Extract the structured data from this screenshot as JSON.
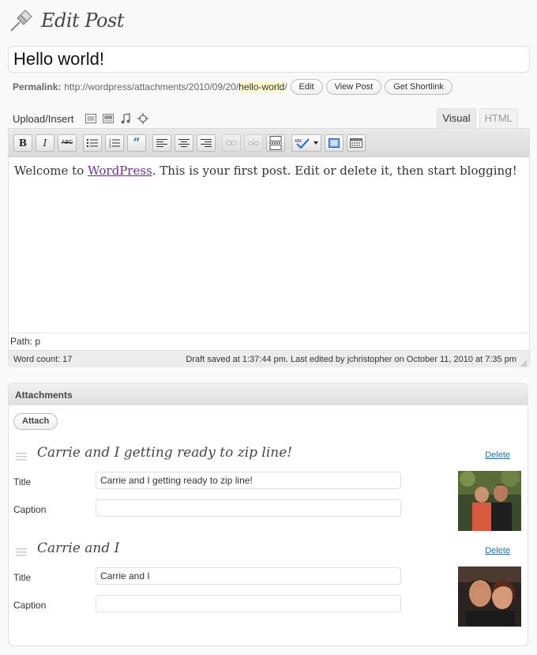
{
  "header": {
    "title": "Edit Post",
    "icon": "pushpin-icon"
  },
  "post_title": "Hello world!",
  "permalink": {
    "label": "Permalink:",
    "url_prefix": "http://wordpress/attachments/2010/09/20/",
    "slug": "hello-world",
    "url_suffix": "/",
    "edit_label": "Edit",
    "view_label": "View Post",
    "shortlink_label": "Get Shortlink"
  },
  "media": {
    "label": "Upload/Insert",
    "icons": [
      "image-icon",
      "video-icon",
      "audio-icon",
      "media-icon"
    ]
  },
  "tabs": {
    "visual": "Visual",
    "html": "HTML"
  },
  "toolbar": {
    "buttons": [
      "bold",
      "italic",
      "strikethrough",
      "unordered-list",
      "ordered-list",
      "blockquote",
      "align-left",
      "align-center",
      "align-right",
      "insert-link",
      "unlink",
      "insert-more",
      "spellcheck",
      "fullscreen",
      "kitchen-sink"
    ],
    "strike_label": "ABC"
  },
  "content": {
    "before_link": "Welcome to ",
    "link_text": "WordPress",
    "after_link": ". This is your first post. Edit or delete it, then start blogging!"
  },
  "path": "Path: p",
  "status": {
    "word_count": "Word count: 17",
    "draft_info": "Draft saved at 1:37:44 pm. Last edited by jchristopher on October 11, 2010 at 7:35 pm"
  },
  "attachments": {
    "header": "Attachments",
    "attach_label": "Attach",
    "items": [
      {
        "heading": "Carrie and I getting ready to zip line!",
        "delete_label": "Delete",
        "title_label": "Title",
        "title_value": "Carrie and I getting ready to zip line!",
        "caption_label": "Caption",
        "caption_value": ""
      },
      {
        "heading": "Carrie and I",
        "delete_label": "Delete",
        "title_label": "Title",
        "title_value": "Carrie and I",
        "caption_label": "Caption",
        "caption_value": ""
      }
    ]
  },
  "colors": {
    "link": "#21759b",
    "visited_link": "#6b2f8a",
    "slug_highlight": "#fffbcc"
  }
}
